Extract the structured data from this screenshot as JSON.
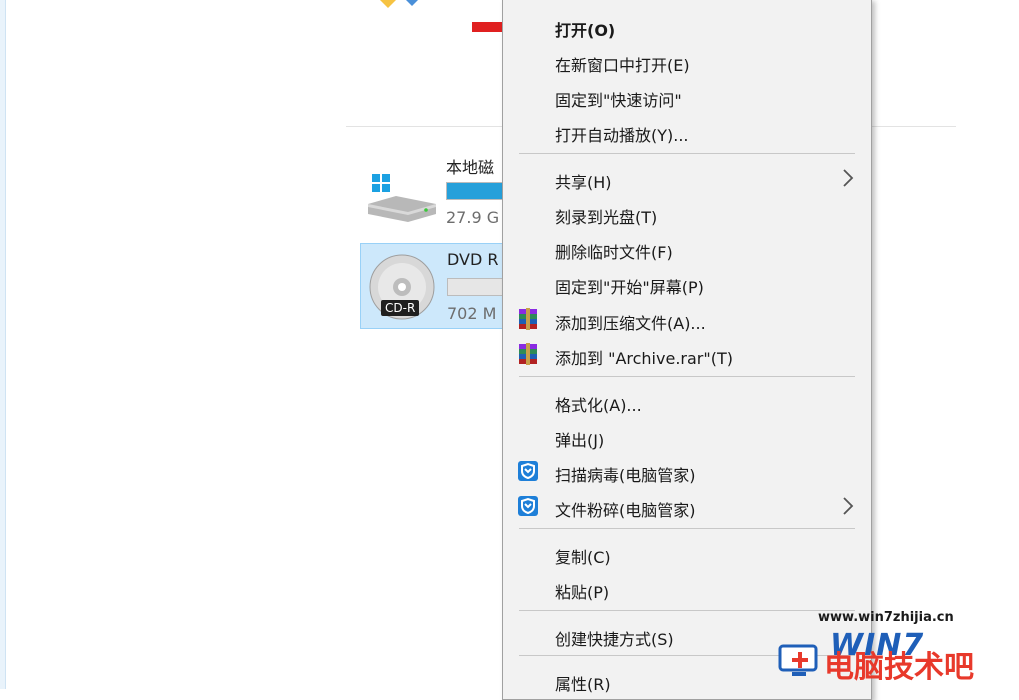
{
  "drives": {
    "local": {
      "name": "本地磁",
      "size": "27.9 G",
      "usage_fraction": 0.9
    },
    "dvd": {
      "name": "DVD R",
      "size": "702 M",
      "badge": "CD-R",
      "usage_fraction": 0.0
    }
  },
  "menu": {
    "items": [
      {
        "label": "打开(O)",
        "bold": true
      },
      {
        "label": "在新窗口中打开(E)"
      },
      {
        "label": "固定到\"快速访问\""
      },
      {
        "label": "打开自动播放(Y)..."
      },
      {
        "label": "共享(H)",
        "submenu": true
      },
      {
        "label": "刻录到光盘(T)"
      },
      {
        "label": "删除临时文件(F)"
      },
      {
        "label": "固定到\"开始\"屏幕(P)"
      },
      {
        "label": "添加到压缩文件(A)...",
        "icon": "winrar-icon"
      },
      {
        "label": "添加到 \"Archive.rar\"(T)",
        "icon": "winrar-icon"
      },
      {
        "label": "格式化(A)..."
      },
      {
        "label": "弹出(J)"
      },
      {
        "label": "扫描病毒(电脑管家)",
        "icon": "tencent-shield-icon"
      },
      {
        "label": "文件粉碎(电脑管家)",
        "icon": "tencent-shield-icon",
        "submenu": true
      },
      {
        "label": "复制(C)"
      },
      {
        "label": "粘贴(P)"
      },
      {
        "label": "创建快捷方式(S)"
      },
      {
        "label": "属性(R)"
      }
    ]
  },
  "watermark": {
    "url": "www.win7zhijia.cn",
    "logo": "WIN7",
    "text": "电脑技术吧"
  },
  "colors": {
    "accent": "#26a0da",
    "arrow": "#e02020",
    "menu_bg": "#f2f2f2",
    "selected_bg": "#cde8fb"
  }
}
